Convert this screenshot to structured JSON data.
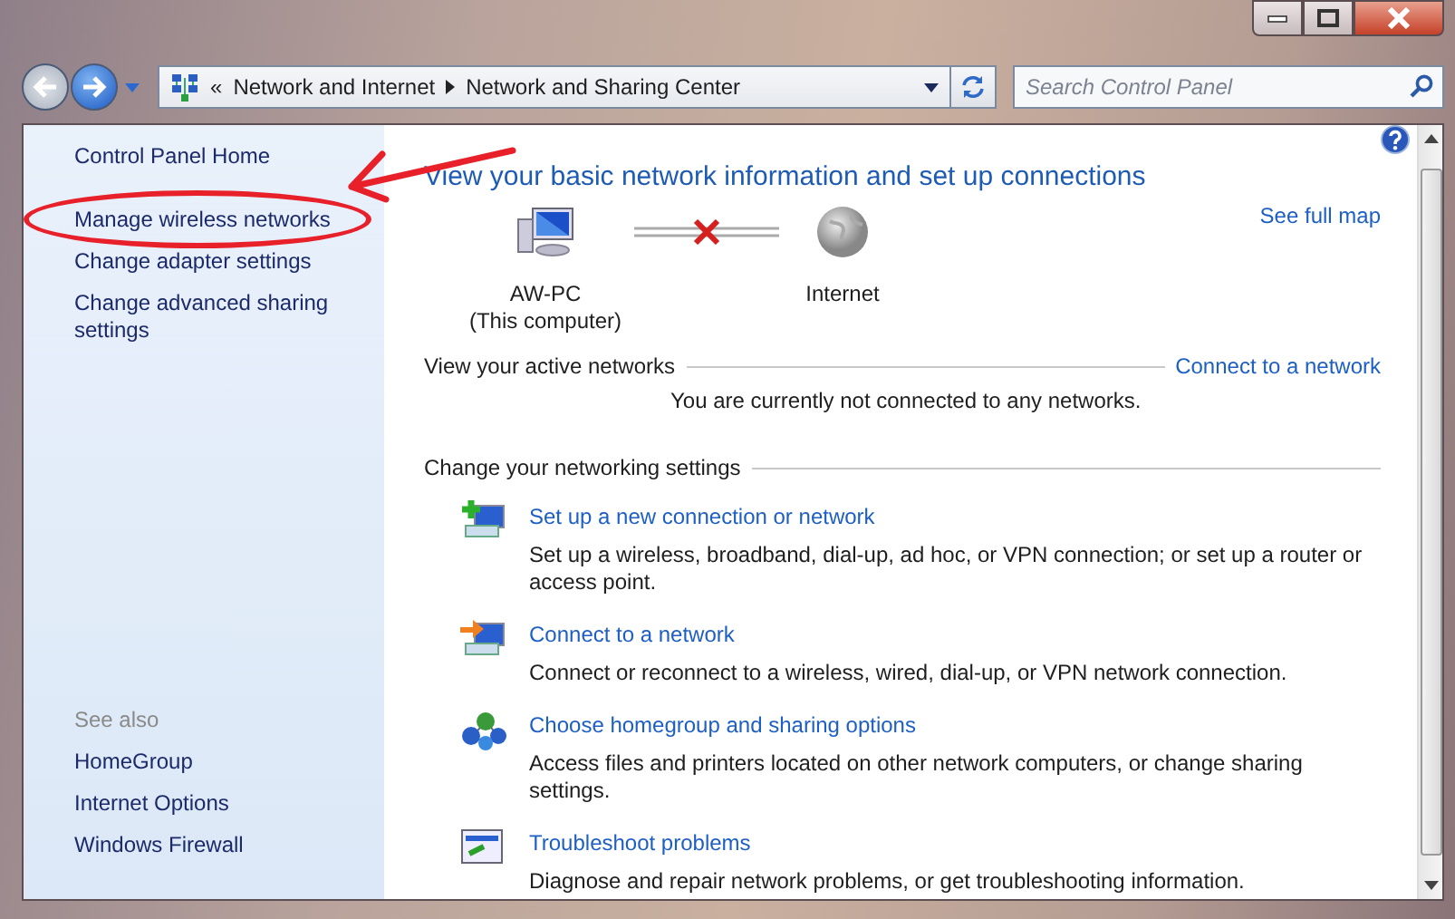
{
  "address_bar": {
    "overflow": "«",
    "path": [
      "Network and Internet",
      "Network and Sharing Center"
    ]
  },
  "search": {
    "placeholder": "Search Control Panel"
  },
  "sidebar": {
    "links": [
      {
        "label": "Control Panel Home",
        "highlighted": false
      },
      {
        "label": "Manage wireless networks",
        "highlighted": true
      },
      {
        "label": "Change adapter settings",
        "highlighted": false
      },
      {
        "label": "Change advanced sharing settings",
        "highlighted": false
      }
    ],
    "see_also_heading": "See also",
    "see_also": [
      "HomeGroup",
      "Internet Options",
      "Windows Firewall"
    ]
  },
  "heading": "View your basic network information and set up connections",
  "map": {
    "nodes": [
      {
        "kind": "computer",
        "name": "AW-PC",
        "subtitle": "(This computer)"
      },
      {
        "kind": "internet",
        "name": "Internet"
      }
    ],
    "connected": false,
    "link": "See full map"
  },
  "active_networks": {
    "title": "View your active networks",
    "link": "Connect to a network",
    "message": "You are currently not connected to any networks."
  },
  "settings": {
    "title": "Change your networking settings",
    "tasks": [
      {
        "kind": "new-connection",
        "link": "Set up a new connection or network",
        "description": "Set up a wireless, broadband, dial-up, ad hoc, or VPN connection; or set up a router or access point."
      },
      {
        "kind": "connect",
        "link": "Connect to a network",
        "description": "Connect or reconnect to a wireless, wired, dial-up, or VPN network connection."
      },
      {
        "kind": "homegroup",
        "link": "Choose homegroup and sharing options",
        "description": "Access files and printers located on other network computers, or change sharing settings."
      },
      {
        "kind": "troubleshoot",
        "link": "Troubleshoot problems",
        "description": "Diagnose and repair network problems, or get troubleshooting information."
      }
    ]
  }
}
